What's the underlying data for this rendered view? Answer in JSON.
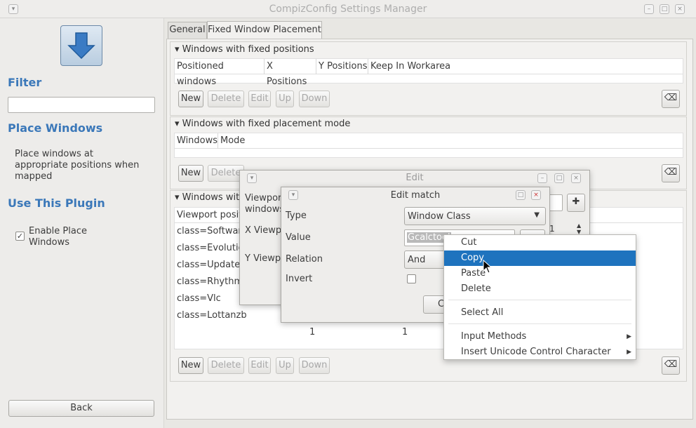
{
  "window": {
    "title": "CompizConfig Settings Manager"
  },
  "sidebar": {
    "filter_heading": "Filter",
    "filter_value": "",
    "place_heading": "Place Windows",
    "description": "Place windows at appropriate positions when mapped",
    "use_heading": "Use This Plugin",
    "enable_label": "Enable Place Windows",
    "enable_checked": true,
    "back_label": "Back"
  },
  "tabs": [
    {
      "label": "General",
      "active": false
    },
    {
      "label": "Fixed Window Placement",
      "active": true
    }
  ],
  "sections": {
    "fixed_positions": {
      "title": "Windows with fixed positions",
      "columns": [
        "Positioned windows",
        "X Positions",
        "Y Positions",
        "Keep In Workarea"
      ]
    },
    "fixed_mode": {
      "title": "Windows with fixed placement mode",
      "columns": [
        "Windows",
        "Mode"
      ]
    },
    "viewport": {
      "title": "Windows with",
      "column": "Viewport posit",
      "rows": [
        "class=Software",
        "class=Evolutio",
        "class=Update-",
        "class=Rhythmb",
        "class=Vlc",
        "class=Lottanzb"
      ],
      "last_row": [
        "1",
        "1"
      ]
    }
  },
  "buttons": {
    "new": "New",
    "delete": "Delete",
    "edit": "Edit",
    "up": "Up",
    "down": "Down"
  },
  "edit_dialog": {
    "title": "Edit",
    "field1": "Viewpor windows",
    "field2": "X Viewp",
    "field3": "Y Viewp",
    "spin_value": "1"
  },
  "edit_match": {
    "title": "Edit match",
    "type_label": "Type",
    "type_value": "Window Class",
    "value_label": "Value",
    "value_text": "Gcalctool",
    "relation_label": "Relation",
    "relation_value": "And",
    "invert_label": "Invert",
    "cancel_partial": "C"
  },
  "context_menu": {
    "items": [
      "Cut",
      "Copy",
      "Paste",
      "Delete"
    ],
    "select_all": "Select All",
    "input_methods": "Input Methods",
    "insert_unicode": "Insert Unicode Control Character",
    "selected": "Copy"
  }
}
